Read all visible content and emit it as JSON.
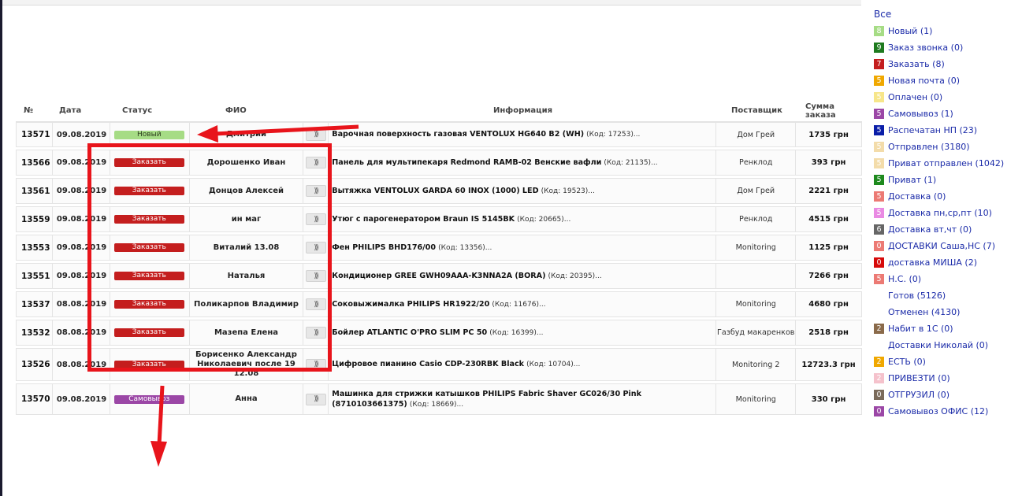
{
  "colors": {
    "link": "#1a2aa8",
    "annotation": "#e8141b",
    "badge_new": "#a6dc85",
    "badge_order": "#c41e1e",
    "badge_pickup": "#9b47a6"
  },
  "table": {
    "headers": {
      "num": "№",
      "date": "Дата",
      "status": "Статус",
      "fio": "ФИО",
      "info": "Информация",
      "supplier": "Поставщик",
      "sum": "Сумма заказа"
    },
    "action_icon": "double-chevron-right-icon",
    "rows": [
      {
        "num": "13571",
        "date": "09.08.2019",
        "status": "Новый",
        "status_color": "#a6dc85",
        "status_text_color": "#2d3e1f",
        "fio": "Дмитрий",
        "product": "Варочная поверхность газовая VENTOLUX HG640 B2 (WH)",
        "code": "(Код: 17253)...",
        "supplier": "Дом Грей",
        "sum": "1735 грн"
      },
      {
        "num": "13566",
        "date": "09.08.2019",
        "status": "Заказать",
        "status_color": "#c41e1e",
        "status_text_color": "#ffffff",
        "fio": "Дорошенко Иван",
        "product": "Панель для мультипекаря Redmond RAMB-02 Венские вафли",
        "code": "(Код: 21135)...",
        "supplier": "Ренклод",
        "sum": "393 грн"
      },
      {
        "num": "13561",
        "date": "09.08.2019",
        "status": "Заказать",
        "status_color": "#c41e1e",
        "status_text_color": "#ffffff",
        "fio": "Донцов Алексей",
        "product": "Вытяжка VENTOLUX GARDA 60 INOX (1000) LED",
        "code": "(Код: 19523)...",
        "supplier": "Дом Грей",
        "sum": "2221 грн"
      },
      {
        "num": "13559",
        "date": "09.08.2019",
        "status": "Заказать",
        "status_color": "#c41e1e",
        "status_text_color": "#ffffff",
        "fio": "ин маг",
        "product": "Утюг с парогенератором Braun IS 5145BK",
        "code": "(Код: 20665)...",
        "supplier": "Ренклод",
        "sum": "4515 грн"
      },
      {
        "num": "13553",
        "date": "09.08.2019",
        "status": "Заказать",
        "status_color": "#c41e1e",
        "status_text_color": "#ffffff",
        "fio": "Виталий 13.08",
        "product": "Фен PHILIPS BHD176/00",
        "code": "(Код: 13356)...",
        "supplier": "Monitoring",
        "sum": "1125 грн"
      },
      {
        "num": "13551",
        "date": "09.08.2019",
        "status": "Заказать",
        "status_color": "#c41e1e",
        "status_text_color": "#ffffff",
        "fio": "Наталья",
        "product": "Кондиционер GREE GWH09AAA-K3NNA2A (BORA)",
        "code": "(Код: 20395)...",
        "supplier": "",
        "sum": "7266 грн"
      },
      {
        "num": "13537",
        "date": "08.08.2019",
        "status": "Заказать",
        "status_color": "#c41e1e",
        "status_text_color": "#ffffff",
        "fio": "Поликарпов Владимир",
        "product": "Соковыжималка PHILIPS HR1922/20",
        "code": "(Код: 11676)...",
        "supplier": "Monitoring",
        "sum": "4680 грн"
      },
      {
        "num": "13532",
        "date": "08.08.2019",
        "status": "Заказать",
        "status_color": "#c41e1e",
        "status_text_color": "#ffffff",
        "fio": "Мазепа Елена",
        "product": "Бойлер ATLANTIC O'PRO SLIM PC 50",
        "code": "(Код: 16399)...",
        "supplier": "Газбуд макаренков",
        "sum": "2518 грн"
      },
      {
        "num": "13526",
        "date": "08.08.2019",
        "status": "Заказать",
        "status_color": "#c41e1e",
        "status_text_color": "#ffffff",
        "fio": "Борисенко Александр Николаевич после 19 12.08",
        "product": "Цифровое пианино Casio CDP-230RBK Black",
        "code": "(Код: 10704)...",
        "supplier": "Monitoring 2",
        "sum": "12723.3 грн"
      },
      {
        "num": "13570",
        "date": "09.08.2019",
        "status": "Самовывоз",
        "status_color": "#9b47a6",
        "status_text_color": "#ffffff",
        "fio": "Анна",
        "product": "Машинка для стрижки катышков PHILIPS Fabric Shaver GC026/30 Pink (8710103661375)",
        "code": "(Код: 18669)...",
        "supplier": "Monitoring",
        "sum": "330 грн"
      }
    ]
  },
  "sidebar": {
    "all_label": "Все",
    "items": [
      {
        "count": "8",
        "color": "#a6dc85",
        "label": "Новый (1)"
      },
      {
        "count": "9",
        "color": "#1e7a1e",
        "label": "Заказ звонка (0)"
      },
      {
        "count": "7",
        "color": "#c41e1e",
        "label": "Заказать (8)"
      },
      {
        "count": "5",
        "color": "#f0a800",
        "label": "Новая почта (0)"
      },
      {
        "count": "5",
        "color": "#f7e68a",
        "label": "Оплачен (0)"
      },
      {
        "count": "5",
        "color": "#9b47a6",
        "label": "Самовывоз (1)"
      },
      {
        "count": "5",
        "color": "#0a1ea8",
        "label": "Распечатан НП (23)"
      },
      {
        "count": "5",
        "color": "#f3dcaa",
        "label": "Отправлен (3180)"
      },
      {
        "count": "5",
        "color": "#f3dcaa",
        "label": "Приват отправлен (1042)"
      },
      {
        "count": "5",
        "color": "#1e8a1e",
        "label": "Приват (1)"
      },
      {
        "count": "5",
        "color": "#ec7a74",
        "label": "Доставка (0)"
      },
      {
        "count": "5",
        "color": "#e98ae3",
        "label": "Доставка пн,ср,пт (10)"
      },
      {
        "count": "6",
        "color": "#666666",
        "label": "Доставка вт,чт (0)"
      },
      {
        "count": "0",
        "color": "#ec7a74",
        "label": "ДОСТАВКИ Саша,НС (7)"
      },
      {
        "count": "0",
        "color": "#d60a0a",
        "label": "доставка МИША (2)"
      },
      {
        "count": "5",
        "color": "#ec7a74",
        "label": "Н.С. (0)"
      },
      {
        "count": "",
        "color": "transparent",
        "label": "Готов (5126)"
      },
      {
        "count": "",
        "color": "transparent",
        "label": "Отменен (4130)"
      },
      {
        "count": "2",
        "color": "#8a6a4a",
        "label": "Набит в 1С (0)"
      },
      {
        "count": "",
        "color": "transparent",
        "label": "Доставки Николай (0)"
      },
      {
        "count": "2",
        "color": "#f0a800",
        "label": "ЕСТЬ (0)"
      },
      {
        "count": "2",
        "color": "#f5c2cc",
        "label": "ПРИВЕЗТИ (0)"
      },
      {
        "count": "0",
        "color": "#7a6a5a",
        "label": "ОТГРУЗИЛ (0)"
      },
      {
        "count": "0",
        "color": "#9b47a6",
        "label": "Самовывоз ОФИС (12)"
      }
    ]
  }
}
